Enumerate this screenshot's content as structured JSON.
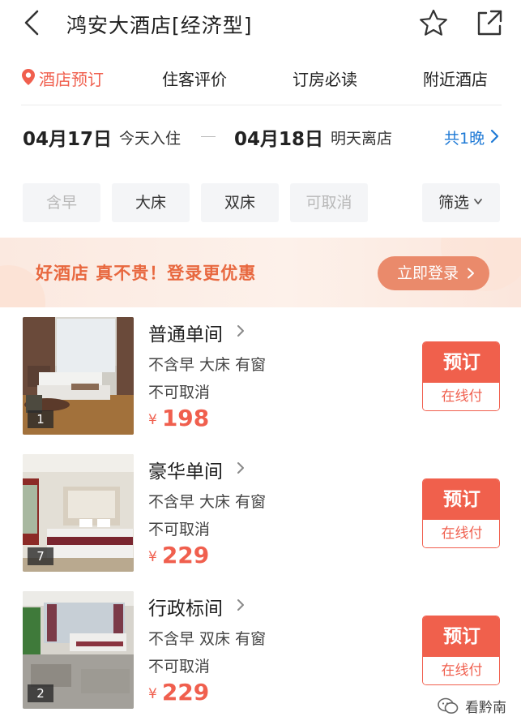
{
  "header": {
    "title": "鸿安大酒店[经济型]",
    "icons": [
      "back-arrow-icon",
      "star-icon",
      "share-icon"
    ]
  },
  "tabs": [
    {
      "label": "酒店预订",
      "active": true
    },
    {
      "label": "住客评价",
      "active": false
    },
    {
      "label": "订房必读",
      "active": false
    },
    {
      "label": "附近酒店",
      "active": false
    }
  ],
  "dates": {
    "checkin_date": "04月17日",
    "checkin_label": "今天入住",
    "checkout_date": "04月18日",
    "checkout_label": "明天离店",
    "nights": "共1晚"
  },
  "filters": {
    "chips": [
      {
        "label": "含早",
        "enabled": false
      },
      {
        "label": "大床",
        "enabled": true
      },
      {
        "label": "双床",
        "enabled": true
      },
      {
        "label": "可取消",
        "enabled": false
      }
    ],
    "filter_button": "筛选"
  },
  "promo": {
    "text": "好酒店 真不贵！登录更优惠",
    "button": "立即登录"
  },
  "rooms": [
    {
      "name": "普通单间",
      "features": "不含早 大床 有窗",
      "cancel": "不可取消",
      "currency": "¥",
      "price": "198",
      "photo_count": "1",
      "book_label": "预订",
      "pay_label": "在线付"
    },
    {
      "name": "豪华单间",
      "features": "不含早 大床 有窗",
      "cancel": "不可取消",
      "currency": "¥",
      "price": "229",
      "photo_count": "7",
      "book_label": "预订",
      "pay_label": "在线付"
    },
    {
      "name": "行政标间",
      "features": "不含早 双床 有窗",
      "cancel": "不可取消",
      "currency": "¥",
      "price": "229",
      "photo_count": "2",
      "book_label": "预订",
      "pay_label": "在线付"
    }
  ],
  "watermark": {
    "text": "看黔南"
  },
  "colors": {
    "accent": "#f05f4e",
    "link": "#1f7ad6",
    "promo_text": "#e8683f",
    "promo_button": "#ea8a6b"
  }
}
